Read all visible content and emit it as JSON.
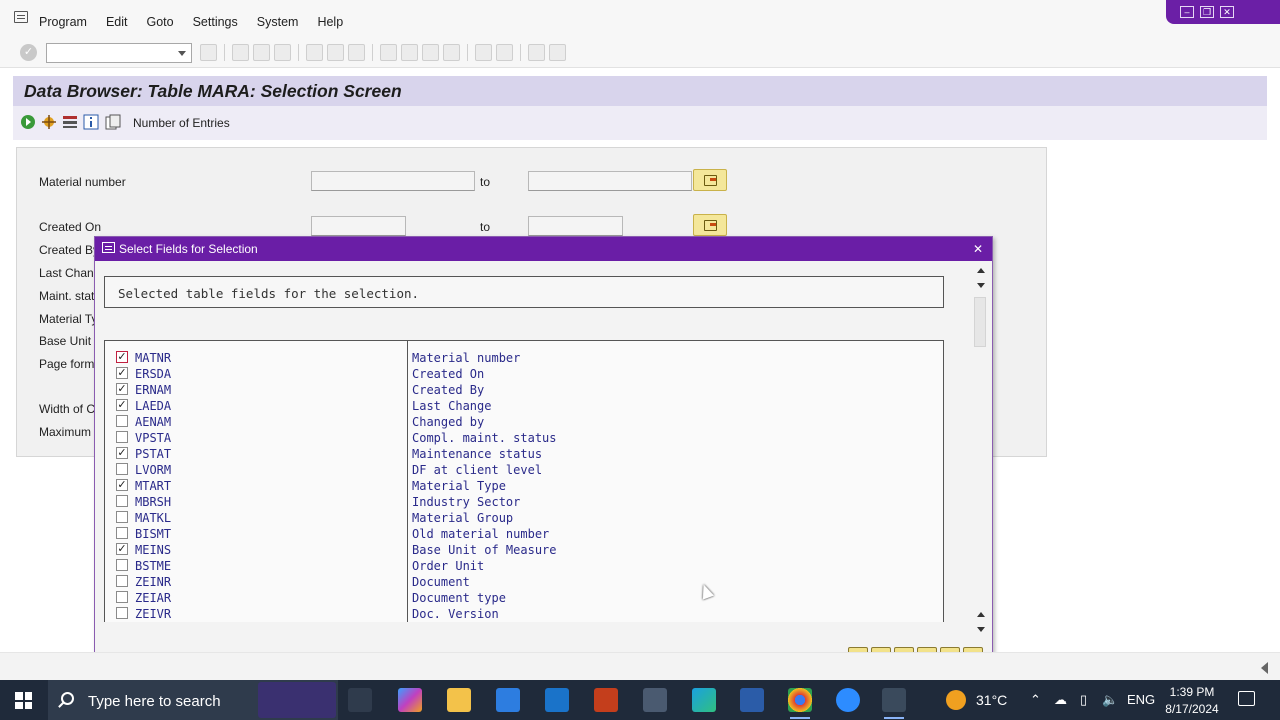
{
  "menu": {
    "items": [
      "Program",
      "Edit",
      "Goto",
      "Settings",
      "System",
      "Help"
    ]
  },
  "window_controls": {
    "minimize": "–",
    "restore": "❐",
    "close": "✕"
  },
  "title": "Data Browser: Table MARA: Selection Screen",
  "app_toolbar": {
    "number_of_entries_label": "Number of Entries"
  },
  "selection": {
    "to_label": "to",
    "fields": [
      {
        "label": "Material number"
      },
      {
        "label": "Created On"
      },
      {
        "label": "Created By"
      },
      {
        "label": "Last Chang"
      },
      {
        "label": "Maint. stat"
      },
      {
        "label": "Material Ty"
      },
      {
        "label": "Base Unit"
      },
      {
        "label": "Page forma"
      },
      {
        "label": "Width of C"
      },
      {
        "label": "Maximum"
      }
    ]
  },
  "dialog": {
    "title": "Select Fields for Selection",
    "info_text": "Selected table fields for the selection.",
    "rows": [
      {
        "field": "MATNR",
        "description": "Material number",
        "checked": true
      },
      {
        "field": "ERSDA",
        "description": "Created On",
        "checked": true
      },
      {
        "field": "ERNAM",
        "description": "Created By",
        "checked": true
      },
      {
        "field": "LAEDA",
        "description": "Last Change",
        "checked": true
      },
      {
        "field": "AENAM",
        "description": "Changed by",
        "checked": false
      },
      {
        "field": "VPSTA",
        "description": "Compl. maint. status",
        "checked": false
      },
      {
        "field": "PSTAT",
        "description": "Maintenance status",
        "checked": true
      },
      {
        "field": "LVORM",
        "description": "DF at client level",
        "checked": false
      },
      {
        "field": "MTART",
        "description": "Material Type",
        "checked": true
      },
      {
        "field": "MBRSH",
        "description": "Industry Sector",
        "checked": false
      },
      {
        "field": "MATKL",
        "description": "Material Group",
        "checked": false
      },
      {
        "field": "BISMT",
        "description": "Old material number",
        "checked": false
      },
      {
        "field": "MEINS",
        "description": "Base Unit of Measure",
        "checked": true
      },
      {
        "field": "BSTME",
        "description": "Order Unit",
        "checked": false
      },
      {
        "field": "ZEINR",
        "description": "Document",
        "checked": false
      },
      {
        "field": "ZEIAR",
        "description": "Document type",
        "checked": false
      },
      {
        "field": "ZEIVR",
        "description": "Doc. Version",
        "checked": false
      }
    ],
    "footer_icons": [
      "check-icon",
      "select-all-icon",
      "deselect-all-icon",
      "print-icon",
      "find-icon",
      "cancel-icon"
    ]
  },
  "taskbar": {
    "search_placeholder": "Type here to search",
    "weather": "31°C",
    "language": "ENG",
    "time": "1:39 PM",
    "date": "8/17/2024",
    "apps": [
      "task-view-icon",
      "copilot-icon",
      "file-explorer-icon",
      "microsoft-store-icon",
      "mail-icon",
      "powerpoint-icon",
      "camera-app-icon",
      "edge-icon",
      "word-icon",
      "chrome-icon",
      "zoom-icon",
      "sap-logon-icon"
    ]
  },
  "colors": {
    "sap_purple": "#6a1ea6",
    "title_band": "#d8d4ec",
    "taskbar": "#1f2a3a"
  }
}
